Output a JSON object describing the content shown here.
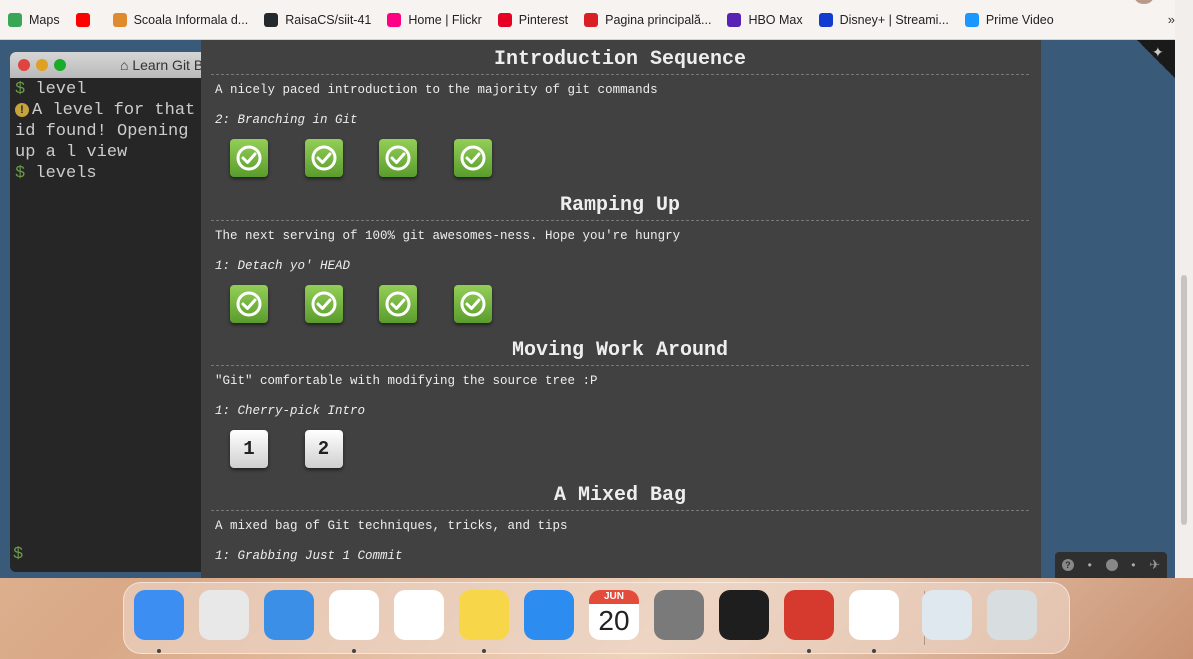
{
  "bookmarks": [
    {
      "label": "Maps",
      "icon": "maps-icon",
      "color": "#3aa757"
    },
    {
      "label": "",
      "icon": "youtube-icon",
      "color": "#ff0000"
    },
    {
      "label": "Scoala Informala d...",
      "icon": "scoala-icon",
      "color": "#e08a2e"
    },
    {
      "label": "RaisaCS/siit-41",
      "icon": "github-icon",
      "color": "#24292e"
    },
    {
      "label": "Home | Flickr",
      "icon": "flickr-icon",
      "color": "#ff0084"
    },
    {
      "label": "Pinterest",
      "icon": "pinterest-icon",
      "color": "#e60023"
    },
    {
      "label": "Pagina principală...",
      "icon": "wikipedia-netflix-icon",
      "color": "#d81f26"
    },
    {
      "label": "HBO Max",
      "icon": "hbo-max-icon",
      "color": "#5822b4"
    },
    {
      "label": "Disney+ | Streami...",
      "icon": "disney-icon",
      "color": "#113ccf"
    },
    {
      "label": "Prime Video",
      "icon": "prime-video-icon",
      "color": "#1a98ff"
    }
  ],
  "bookmarks_more": "»",
  "terminal": {
    "title": "Learn Git B",
    "prompt": "$",
    "line1": "level",
    "line2": "A level for that id found! Opening up a l view",
    "line3": "levels"
  },
  "sequences": [
    {
      "title": "Introduction Sequence",
      "about": "A nicely paced introduction to the majority of git commands",
      "level": "2: Branching in Git",
      "levels": [
        {
          "done": true
        },
        {
          "done": true
        },
        {
          "done": true
        },
        {
          "done": true
        }
      ]
    },
    {
      "title": "Ramping Up",
      "about": "The next serving of 100% git awesomes-ness. Hope you're hungry",
      "level": "1: Detach yo' HEAD",
      "levels": [
        {
          "done": true
        },
        {
          "done": true
        },
        {
          "done": true
        },
        {
          "done": true
        }
      ]
    },
    {
      "title": "Moving Work Around",
      "about": "\"Git\" comfortable with modifying the source tree :P",
      "level": "1: Cherry-pick Intro",
      "levels": [
        {
          "done": false,
          "label": "1"
        },
        {
          "done": false,
          "label": "2"
        }
      ]
    },
    {
      "title": "A Mixed Bag",
      "about": "A mixed bag of Git techniques, tricks, and tips",
      "level": "1: Grabbing Just 1 Commit",
      "levels": []
    }
  ],
  "widget": {
    "help": "?",
    "globe": "globe-icon",
    "twitter": "twitter-icon"
  },
  "dock": [
    {
      "name": "finder",
      "color": "#3d8ef2",
      "running": true
    },
    {
      "name": "launchpad",
      "color": "#e8e8e8",
      "running": false
    },
    {
      "name": "mail",
      "color": "#3b8fe6",
      "running": false
    },
    {
      "name": "chrome",
      "color": "#ffffff",
      "running": true
    },
    {
      "name": "photos",
      "color": "#ffffff",
      "running": false
    },
    {
      "name": "notes",
      "color": "#f7d64a",
      "running": true
    },
    {
      "name": "app-store",
      "color": "#2d8cf0",
      "running": false
    },
    {
      "name": "calendar",
      "color": "#ffffff",
      "running": false,
      "month": "JUN",
      "day": "20"
    },
    {
      "name": "system-preferences",
      "color": "#7a7a7a",
      "running": false
    },
    {
      "name": "figma",
      "color": "#1e1e1e",
      "running": false
    },
    {
      "name": "git-app",
      "color": "#d63a2f",
      "running": true
    },
    {
      "name": "vscode",
      "color": "#ffffff",
      "running": true
    },
    {
      "name": "recent-document",
      "color": "#dfe8ee",
      "running": false
    },
    {
      "name": "trash",
      "color": "#d8dde0",
      "running": false
    }
  ]
}
